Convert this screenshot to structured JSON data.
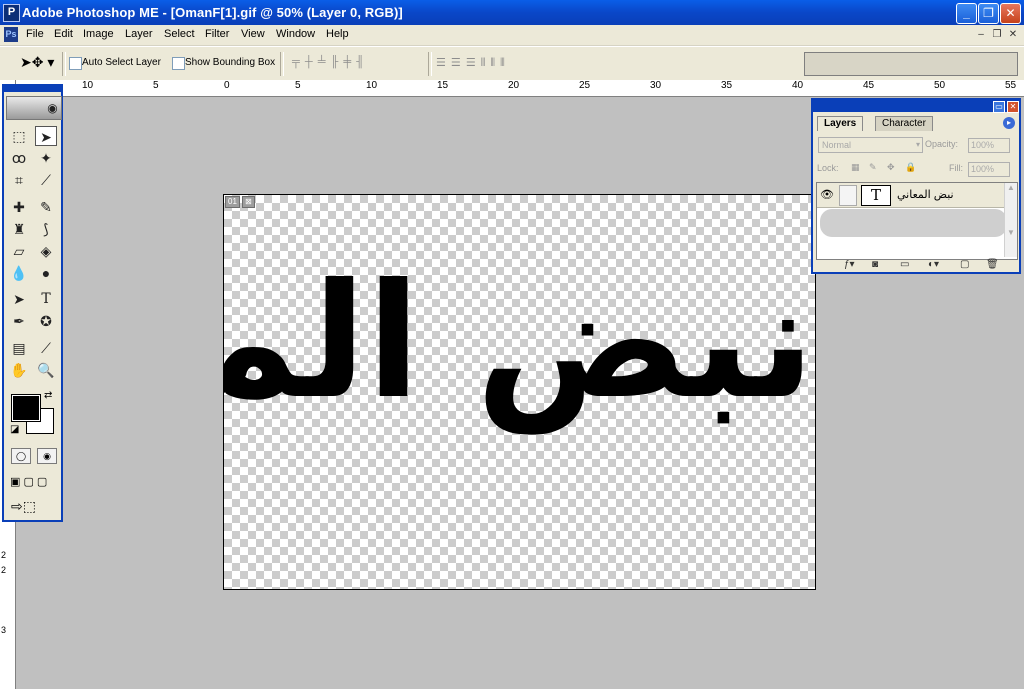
{
  "window": {
    "title": "Adobe Photoshop ME - [OmanF[1].gif @ 50% (Layer 0, RGB)]",
    "icon": "photoshop-icon",
    "controls": [
      "minimize",
      "restore",
      "close"
    ]
  },
  "menu": {
    "items": [
      "File",
      "Edit",
      "Image",
      "Layer",
      "Select",
      "Filter",
      "View",
      "Window",
      "Help"
    ]
  },
  "options": {
    "auto_select_label": "Auto Select Layer",
    "bounding_box_label": "Show Bounding Box"
  },
  "ruler": {
    "h_labels": [
      "10",
      "5",
      "0",
      "5",
      "10",
      "15",
      "20",
      "25",
      "30",
      "35",
      "40",
      "45",
      "50",
      "55"
    ],
    "v_labels": [
      "2",
      "2",
      "3"
    ]
  },
  "document": {
    "slice_tag": "01",
    "text": "نبض المعاني",
    "background": "transparent-checkerboard",
    "text_color": "#000000"
  },
  "toolbox": {
    "foreground_color": "#000000",
    "background_color": "#ffffff",
    "active_tool": "move-tool"
  },
  "layers_palette": {
    "tabs": [
      "Layers",
      "Character"
    ],
    "blend_mode": "Normal",
    "opacity_label": "Opacity:",
    "opacity_value": "100%",
    "lock_label": "Lock:",
    "fill_label": "Fill:",
    "fill_value": "100%",
    "layer_name": "نبض المعاني",
    "layer_thumb": "T"
  },
  "colors": {
    "titlebar": "#0a47c8",
    "chrome": "#ece9d8",
    "workspace": "#c0c0c0"
  }
}
